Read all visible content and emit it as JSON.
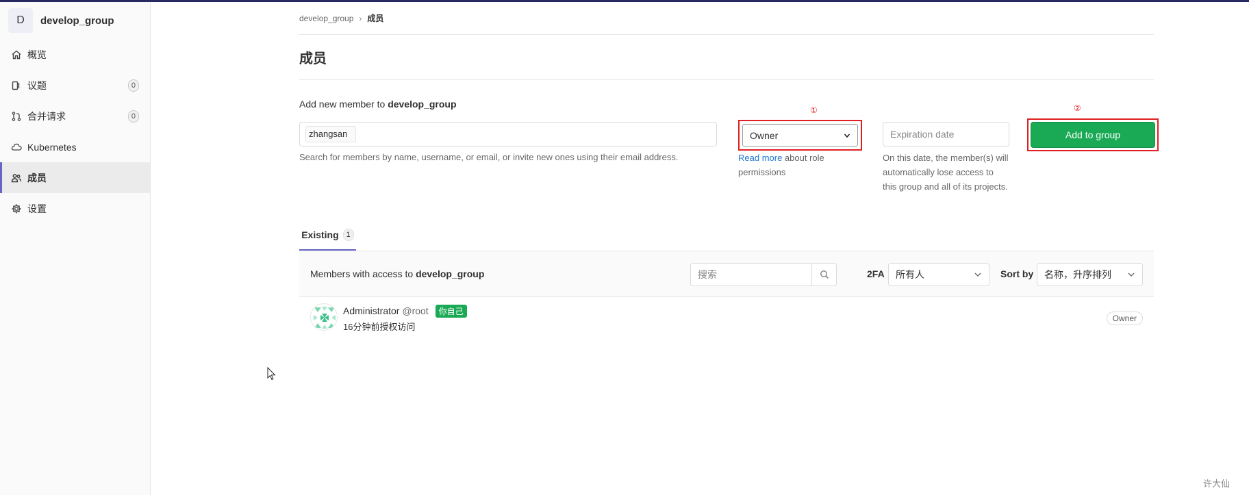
{
  "sidebar": {
    "avatar_letter": "D",
    "group_name": "develop_group",
    "items": [
      {
        "label": "概览",
        "icon": "home-icon"
      },
      {
        "label": "议题",
        "icon": "issues-icon",
        "count": "0"
      },
      {
        "label": "合并请求",
        "icon": "merge-request-icon",
        "count": "0"
      },
      {
        "label": "Kubernetes",
        "icon": "cloud-gear-icon"
      },
      {
        "label": "成员",
        "icon": "users-icon",
        "active": true
      },
      {
        "label": "设置",
        "icon": "gear-icon"
      }
    ]
  },
  "breadcrumb": {
    "group": "develop_group",
    "current": "成员"
  },
  "page_title": "成员",
  "add_member": {
    "label_prefix": "Add new member to",
    "group": "develop_group",
    "search_token": "zhangsan",
    "search_help": "Search for members by name, username, or email, or invite new ones using their email address.",
    "marker_1": "①",
    "marker_2": "②",
    "role_value": "Owner",
    "role_help_link": "Read more",
    "role_help_rest": " about role permissions",
    "expiration_placeholder": "Expiration date",
    "expiration_help": "On this date, the member(s) will automatically lose access to this group and all of its projects.",
    "add_button": "Add to group"
  },
  "tabs": [
    {
      "label": "Existing",
      "count": "1"
    }
  ],
  "members_bar": {
    "text_prefix": "Members with access to",
    "group": "develop_group",
    "search_placeholder": "搜索",
    "twofa_label": "2FA",
    "twofa_value": "所有人",
    "sort_label": "Sort by",
    "sort_value": "名称，升序排列"
  },
  "members": [
    {
      "name": "Administrator",
      "username": "@root",
      "badge": "你自己",
      "granted": "16分钟前授权访问",
      "role": "Owner"
    }
  ],
  "watermark": "许大仙",
  "colors": {
    "accent": "#6666c4",
    "success": "#1aaa55",
    "highlight": "#e02020",
    "link": "#1f78d1"
  }
}
